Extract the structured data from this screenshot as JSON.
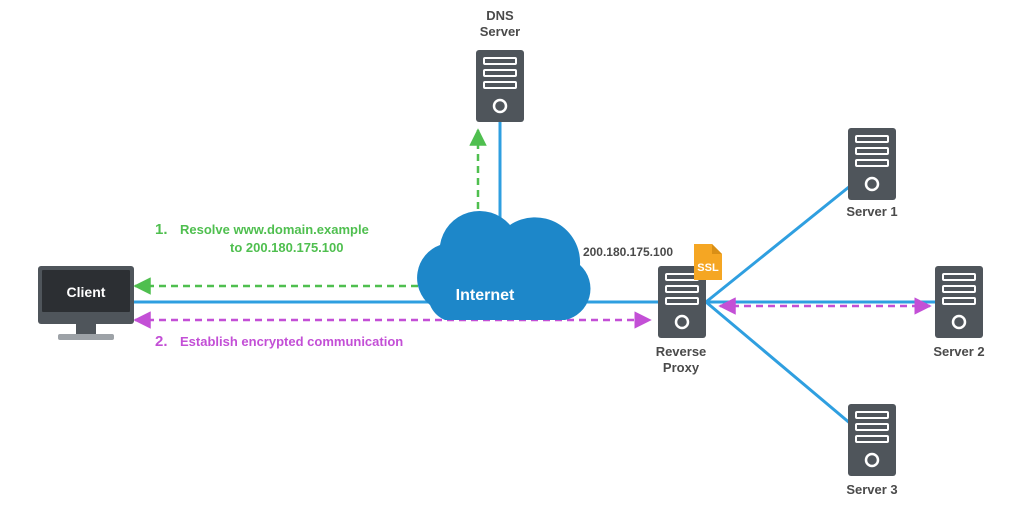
{
  "nodes": {
    "client": {
      "label": "Client"
    },
    "dns": {
      "label_l1": "DNS",
      "label_l2": "Server"
    },
    "cloud": {
      "label": "Internet"
    },
    "proxy": {
      "label_l1": "Reverse",
      "label_l2": "Proxy",
      "ip": "200.180.175.100",
      "ssl_badge": "SSL"
    },
    "server1": {
      "label": "Server 1"
    },
    "server2": {
      "label": "Server 2"
    },
    "server3": {
      "label": "Server 3"
    }
  },
  "steps": {
    "s1": {
      "num": "1.",
      "text_l1": "Resolve www.domain.example",
      "text_l2": "to 200.180.175.100"
    },
    "s2": {
      "num": "2.",
      "text": "Establish encrypted communication"
    }
  },
  "colors": {
    "server_body": "#4f555b",
    "server_accent": "#ffffff",
    "blue_line": "#2f9fe0",
    "cloud": "#1d87c9",
    "green": "#4fbf4f",
    "purple": "#c34fd6",
    "ssl_doc": "#f5a623"
  }
}
